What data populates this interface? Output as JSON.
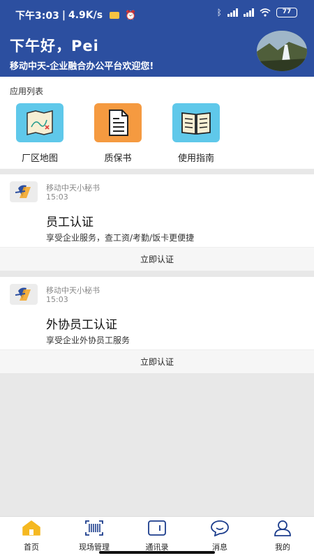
{
  "status_bar": {
    "time": "下午3:03",
    "speed": "4.9K/s",
    "battery": "77"
  },
  "header": {
    "greeting": "下午好，Pei",
    "subtitle": "移动中天-企业融合办公平台欢迎您!"
  },
  "apps": {
    "title": "应用列表",
    "items": [
      {
        "label": "厂区地图",
        "icon": "map-icon",
        "color": "#5fc8ea"
      },
      {
        "label": "质保书",
        "icon": "document-icon",
        "color": "#f59a40"
      },
      {
        "label": "使用指南",
        "icon": "book-icon",
        "color": "#5fc8ea"
      }
    ]
  },
  "cards": [
    {
      "sender": "移动中天小秘书",
      "time": "15:03",
      "title": "员工认证",
      "desc": "享受企业服务，查工资/考勤/饭卡更便捷",
      "action": "立即认证"
    },
    {
      "sender": "移动中天小秘书",
      "time": "15:03",
      "title": "外协员工认证",
      "desc": "享受企业外协员工服务",
      "action": "立即认证"
    }
  ],
  "tabbar": {
    "items": [
      {
        "label": "首页",
        "icon": "home-icon",
        "active": true
      },
      {
        "label": "现场管理",
        "icon": "barcode-icon"
      },
      {
        "label": "通讯录",
        "icon": "wallet-icon"
      },
      {
        "label": "消息",
        "icon": "chat-icon"
      },
      {
        "label": "我的",
        "icon": "user-icon"
      }
    ]
  },
  "colors": {
    "header_bg": "#2c4fa0",
    "tab_icon": "#1c3d8c",
    "home_active": "#f5b820"
  }
}
